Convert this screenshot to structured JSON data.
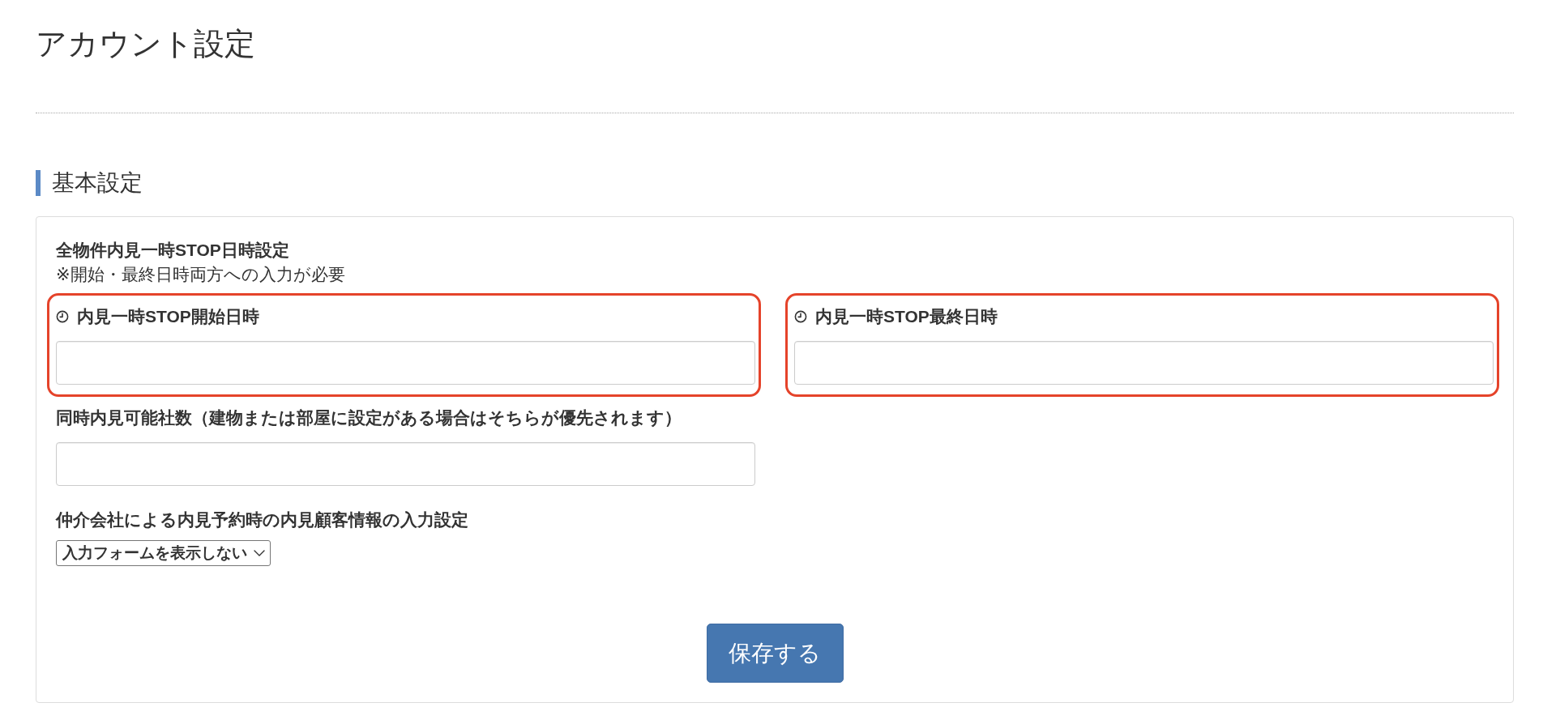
{
  "page": {
    "title": "アカウント設定"
  },
  "section": {
    "heading": "基本設定"
  },
  "form": {
    "heading": "全物件内見一時STOP日時設定",
    "note": "※開始・最終日時両方への入力が必要",
    "fields": [
      {
        "kind": "datetime",
        "label": "内見一時STOP開始日時",
        "highlighted": true
      },
      {
        "kind": "datetime",
        "label": "内見一時STOP最終日時",
        "highlighted": true
      },
      {
        "kind": "text",
        "label": "同時内見可能社数（建物または部屋に設定がある場合はそちらが優先されます）",
        "highlighted": false
      }
    ],
    "customer_info": {
      "label": "仲介会社による内見予約時の内見顧客情報の入力設定",
      "value": "入力フォームを表示しない"
    },
    "save_button": "保存する"
  }
}
